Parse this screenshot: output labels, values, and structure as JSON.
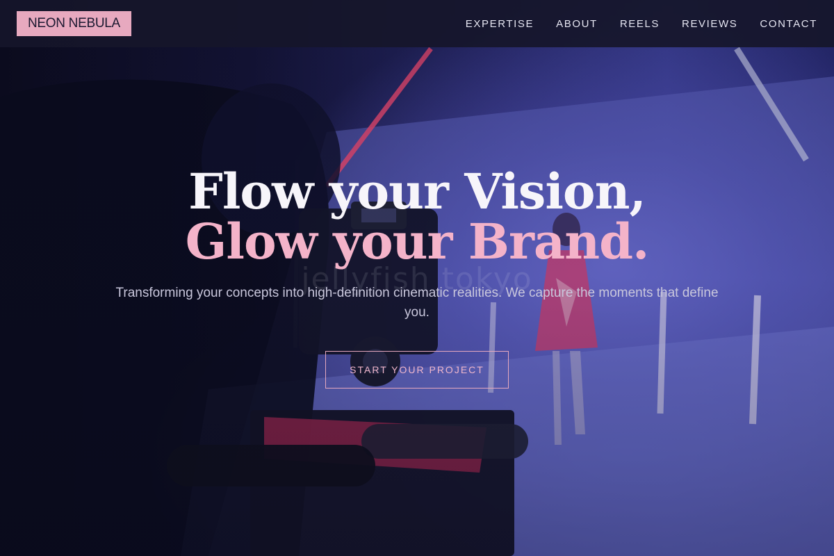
{
  "brand": {
    "name": "NEON NEBULA",
    "accent_color": "#e7a9bf"
  },
  "nav": {
    "items": [
      {
        "label": "EXPERTISE"
      },
      {
        "label": "ABOUT"
      },
      {
        "label": "REELS"
      },
      {
        "label": "REVIEWS"
      },
      {
        "label": "CONTACT"
      }
    ]
  },
  "hero": {
    "headline_line1": "Flow your Vision,",
    "headline_line2": "Glow your Brand.",
    "subtitle": "Transforming your concepts into high-definition cinematic realities. We capture the moments that define you.",
    "cta_label": "START YOUR PROJECT",
    "watermark": "jellyfish tokyo",
    "headline_color": "#f7f5fa",
    "highlight_color": "#f4b3c9"
  }
}
